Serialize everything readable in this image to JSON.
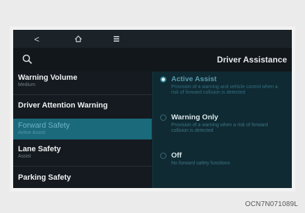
{
  "nav": {
    "back_glyph": "<"
  },
  "header": {
    "title": "Driver Assistance"
  },
  "menu": [
    {
      "label": "Warning Volume",
      "sub": "Medium"
    },
    {
      "label": "Driver Attention Warning",
      "sub": ""
    },
    {
      "label": "Forward Safety",
      "sub": "Active Assist",
      "selected": true
    },
    {
      "label": "Lane Safety",
      "sub": "Assist"
    },
    {
      "label": "Parking Safety",
      "sub": ""
    }
  ],
  "options": [
    {
      "title": "Active Assist",
      "desc": "Provision of a warning and vehicle control when a risk of forward collision is detected",
      "checked": true
    },
    {
      "title": "Warning Only",
      "desc": "Provision of a warning when a risk of forward collision is detected",
      "checked": false
    },
    {
      "title": "Off",
      "desc": "No forward safety functions",
      "checked": false
    }
  ],
  "caption": "OCN7N071089L",
  "colors": {
    "accent": "#1a6a7c",
    "panel": "#0f2a33",
    "screen": "#141a1f"
  },
  "icons": [
    "back-icon",
    "home-icon",
    "menu-icon",
    "search-icon"
  ]
}
